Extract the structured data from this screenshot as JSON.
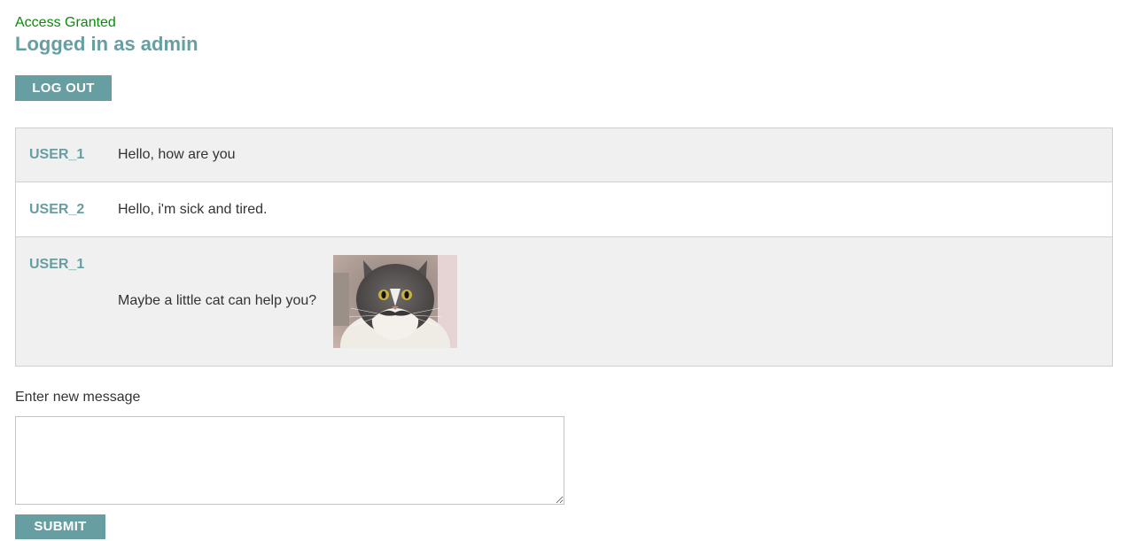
{
  "header": {
    "status": "Access Granted",
    "logged_in": "Logged in as admin",
    "logout_label": "LOG OUT"
  },
  "messages": [
    {
      "user": "USER_1",
      "text": "Hello, how are you"
    },
    {
      "user": "USER_2",
      "text": "Hello, i'm sick and tired."
    },
    {
      "user": "USER_1",
      "text": "Maybe a little cat can help you?",
      "image": "cat-photo"
    }
  ],
  "composer": {
    "label": "Enter new message",
    "value": "",
    "submit_label": "SUBMIT"
  },
  "colors": {
    "accent": "#679ea1",
    "status_green": "#0a8a0a",
    "row_alt": "#f0f0f0"
  }
}
